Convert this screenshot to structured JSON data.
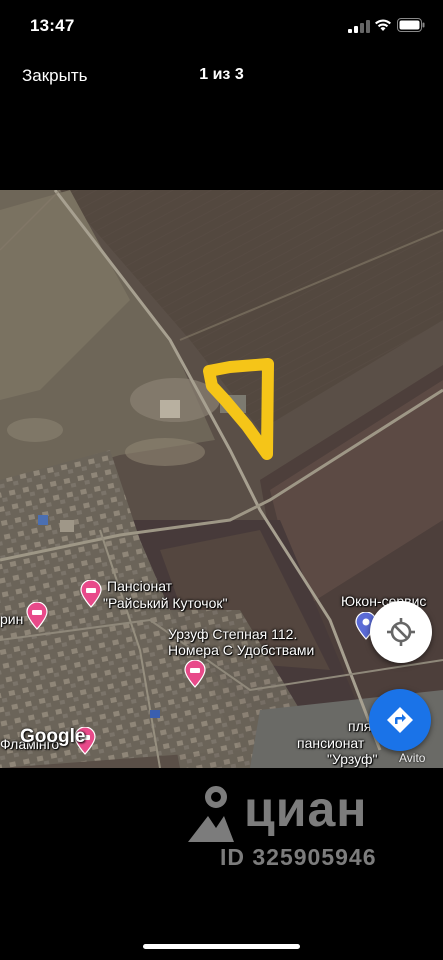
{
  "status": {
    "time": "13:47"
  },
  "nav": {
    "close_label": "Закрыть",
    "counter": "1 из 3"
  },
  "map": {
    "labels": {
      "pansionat_rai_1": "Пансіонат",
      "pansionat_rai_2": "\"Райський Куточок\"",
      "yukon": "Юкон-сервис",
      "rin": "рин",
      "urzuf_1": "Урзуф Степная 112.",
      "urzuf_2": "Номера С Удобствами",
      "flaming": "Фламінго",
      "plya": "пля",
      "pansionat_urzuf_1": "пансионат",
      "pansionat_urzuf_2": "\"Урзуф\""
    },
    "google": "Google",
    "attribution": "Avito",
    "highlight_color": "#f5c518"
  },
  "watermark": {
    "brand": "циан",
    "id": "ID 325905946"
  }
}
